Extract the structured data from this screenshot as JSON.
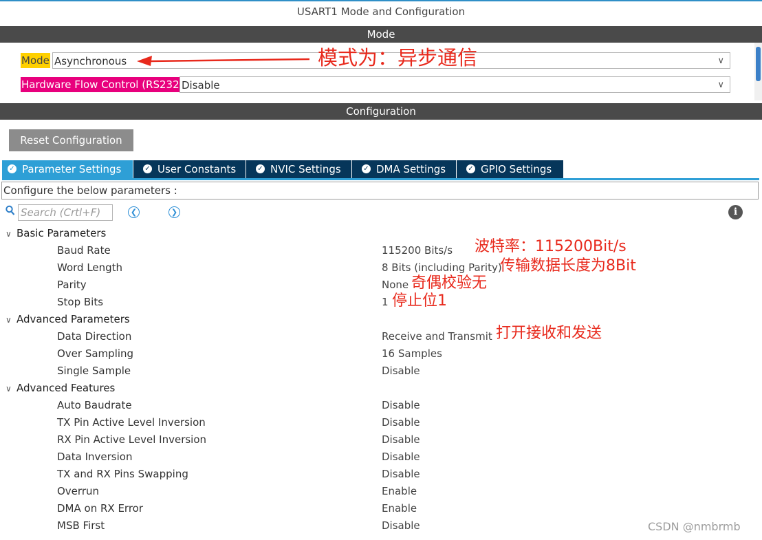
{
  "window": {
    "title": "USART1 Mode and Configuration"
  },
  "colors": {
    "accent": "#2e9fd6",
    "tab_dark": "#06365a",
    "mode_highlight": "#ffd000",
    "hfc_highlight": "#e8007d",
    "annotation": "#e8291c"
  },
  "mode_section": {
    "header": "Mode",
    "mode": {
      "label": "Mode",
      "value": "Asynchronous"
    },
    "hardware_flow": {
      "label": "Hardware Flow Control (RS232)",
      "value": "Disable"
    }
  },
  "config_section": {
    "header": "Configuration",
    "reset_button": "Reset Configuration",
    "tabs": [
      {
        "label": "Parameter Settings"
      },
      {
        "label": "User Constants"
      },
      {
        "label": "NVIC Settings"
      },
      {
        "label": "DMA Settings"
      },
      {
        "label": "GPIO Settings"
      }
    ],
    "description": "Configure the below parameters :",
    "search_placeholder": "Search (Crtl+F)"
  },
  "groups": [
    {
      "name": "Basic Parameters",
      "params": [
        {
          "name": "Baud Rate",
          "value": "115200 Bits/s"
        },
        {
          "name": "Word Length",
          "value": "8 Bits (including Parity)"
        },
        {
          "name": "Parity",
          "value": "None"
        },
        {
          "name": "Stop Bits",
          "value": "1"
        }
      ]
    },
    {
      "name": "Advanced Parameters",
      "params": [
        {
          "name": "Data Direction",
          "value": "Receive and Transmit"
        },
        {
          "name": "Over Sampling",
          "value": "16 Samples"
        },
        {
          "name": "Single Sample",
          "value": "Disable"
        }
      ]
    },
    {
      "name": "Advanced Features",
      "params": [
        {
          "name": "Auto Baudrate",
          "value": "Disable"
        },
        {
          "name": "TX Pin Active Level Inversion",
          "value": "Disable"
        },
        {
          "name": "RX Pin Active Level Inversion",
          "value": "Disable"
        },
        {
          "name": "Data Inversion",
          "value": "Disable"
        },
        {
          "name": "TX and RX Pins Swapping",
          "value": "Disable"
        },
        {
          "name": "Overrun",
          "value": "Enable"
        },
        {
          "name": "DMA on RX Error",
          "value": "Enable"
        },
        {
          "name": "MSB First",
          "value": "Disable"
        }
      ]
    }
  ],
  "annotations": {
    "mode": "模式为：异步通信",
    "baud": "波特率：115200Bit/s",
    "word_length": "传输数据长度为8Bit",
    "parity": "奇偶校验无",
    "stop_bits": "停止位1",
    "direction": "打开接收和发送"
  },
  "watermark": "CSDN @nmbrmb"
}
